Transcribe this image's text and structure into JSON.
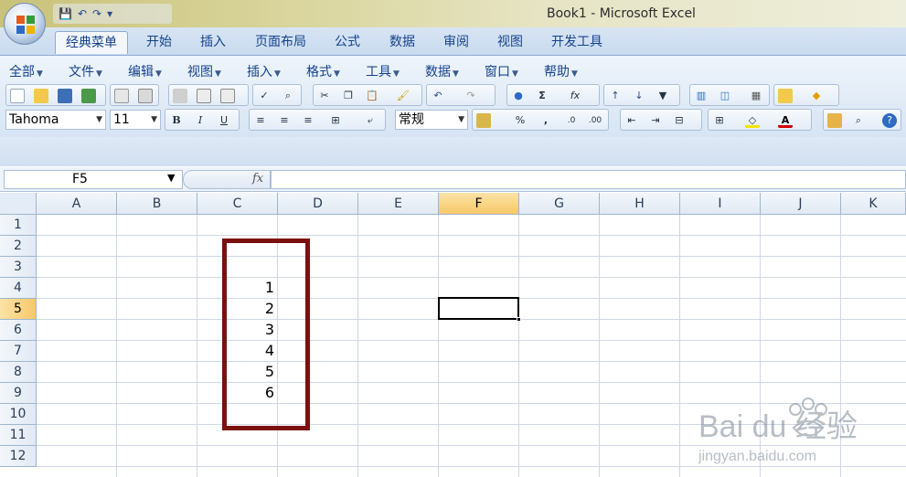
{
  "window": {
    "title": "Book1 - Microsoft Excel"
  },
  "ribbon_tabs": [
    "经典菜单",
    "开始",
    "插入",
    "页面布局",
    "公式",
    "数据",
    "审阅",
    "视图",
    "开发工具"
  ],
  "classic_menu": [
    "全部",
    "文件",
    "编辑",
    "视图",
    "插入",
    "格式",
    "工具",
    "数据",
    "窗口",
    "帮助"
  ],
  "toolbar": {
    "font_name": "Tahoma",
    "font_size": "11",
    "number_format": "常规",
    "bold": "B",
    "italic": "I",
    "underline": "U",
    "percent": "%",
    "comma": ",",
    "sum_symbol": "Σ",
    "fx_symbol": "fx"
  },
  "formula_bar": {
    "name_box": "F5",
    "fx_label": "fx",
    "formula": ""
  },
  "grid": {
    "columns": [
      "A",
      "B",
      "C",
      "D",
      "E",
      "F",
      "G",
      "H",
      "I",
      "J",
      "K"
    ],
    "rows": [
      "1",
      "2",
      "3",
      "4",
      "5",
      "6",
      "7",
      "8",
      "9",
      "10",
      "11",
      "12"
    ],
    "selected_column": "F",
    "selected_row": "5",
    "active_cell": "F5",
    "cells": [
      {
        "ref": "C4",
        "value": "1"
      },
      {
        "ref": "C5",
        "value": "2"
      },
      {
        "ref": "C6",
        "value": "3"
      },
      {
        "ref": "C7",
        "value": "4"
      },
      {
        "ref": "C8",
        "value": "5"
      },
      {
        "ref": "C9",
        "value": "6"
      }
    ]
  },
  "annotation_color": "#7a1010",
  "watermark": {
    "brand": "Bai du 经验",
    "url": "jingyan.baidu.com"
  }
}
